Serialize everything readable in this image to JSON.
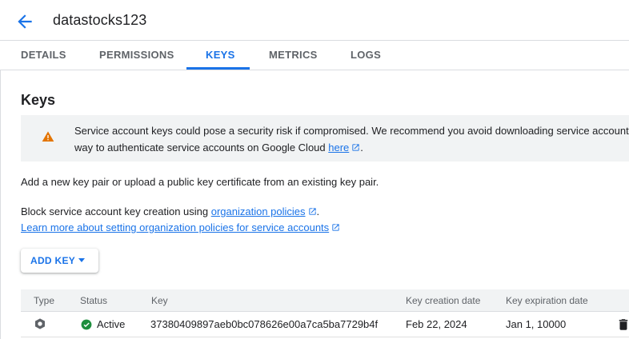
{
  "header": {
    "title": "datastocks123",
    "back_icon": "arrow-back-icon"
  },
  "tabs": [
    {
      "label": "DETAILS",
      "active": false
    },
    {
      "label": "PERMISSIONS",
      "active": false
    },
    {
      "label": "KEYS",
      "active": true
    },
    {
      "label": "METRICS",
      "active": false
    },
    {
      "label": "LOGS",
      "active": false
    }
  ],
  "section": {
    "title": "Keys"
  },
  "warning": {
    "icon": "warning-icon",
    "line1": "Service account keys could pose a security risk if compromised. We recommend you avoid downloading service account",
    "line2_prefix": "way to authenticate service accounts on Google Cloud ",
    "link": "here",
    "line2_suffix": "."
  },
  "intro": {
    "text": "Add a new key pair or upload a public key certificate from an existing key pair."
  },
  "policy": {
    "prefix": "Block service account key creation using ",
    "link": "organization policies",
    "suffix": ".",
    "learn_more": "Learn more about setting organization policies for service accounts"
  },
  "add_key": {
    "label": "ADD KEY"
  },
  "table": {
    "columns": [
      "Type",
      "Status",
      "Key",
      "Key creation date",
      "Key expiration date"
    ],
    "rows": [
      {
        "type_icon": "key-type-icon",
        "status": "Active",
        "status_icon": "check-circle-icon",
        "key": "37380409897aeb0bc078626e00a7ca5ba7729b4f",
        "created": "Feb 22, 2024",
        "expires": "Jan 1, 10000",
        "action_icon": "delete-icon"
      }
    ]
  },
  "colors": {
    "accent": "#1a73e8",
    "warning": "#e37400",
    "success": "#1e8e3e"
  }
}
